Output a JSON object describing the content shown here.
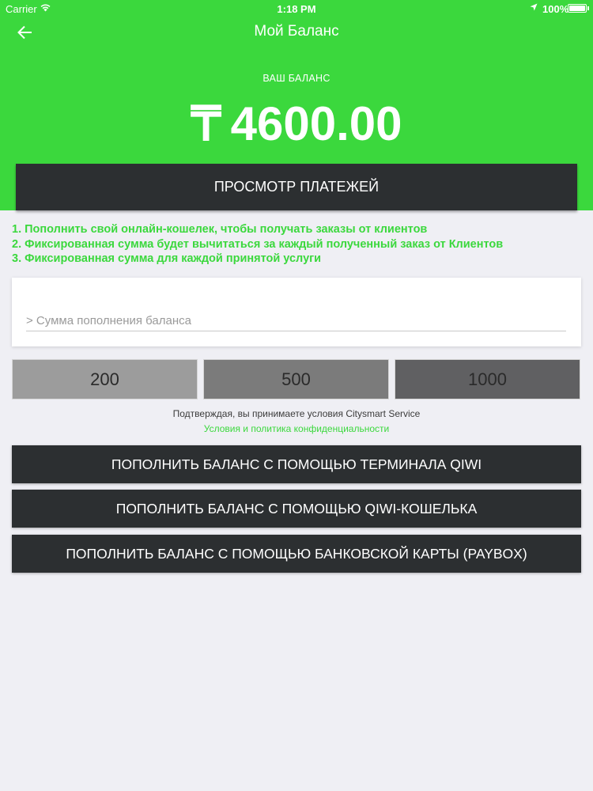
{
  "status_bar": {
    "carrier": "Carrier",
    "time": "1:18 PM",
    "battery": "100%"
  },
  "nav": {
    "title": "Мой Баланс",
    "back_icon": "arrow-left-icon"
  },
  "balance": {
    "label": "ВАШ БАЛАНС",
    "currency_symbol": "₸",
    "amount": "4600.00"
  },
  "payments_button": "ПРОСМОТР ПЛАТЕЖЕЙ",
  "info_lines": [
    "1. Пополнить свой онлайн-кошелек, чтобы получать заказы от клиентов",
    "2. Фиксированная сумма будет вычитаться за каждый полученный заказ от Клиентов",
    "3. Фиксированная сумма для каждой принятой услуги"
  ],
  "amount_input": {
    "value": "",
    "placeholder": "> Сумма пополнения баланса"
  },
  "presets": [
    "200",
    "500",
    "1000"
  ],
  "terms": {
    "text": "Подтверждая, вы принимаете условия Citysmart Service",
    "link": "Условия и политика конфиденциальности"
  },
  "actions": [
    "ПОПОЛНИТЬ БАЛАНС С ПОМОЩЬЮ ТЕРМИНАЛА QIWI",
    "ПОПОЛНИТЬ БАЛАНС С ПОМОЩЬЮ QIWI-КОШЕЛЬКА",
    "ПОПОЛНИТЬ БАЛАНС С ПОМОЩЬЮ БАНКОВСКОЙ КАРТЫ (PAYBOX)"
  ],
  "colors": {
    "accent": "#3bd83d",
    "dark_button": "#2c2f31",
    "background": "#efeff4"
  }
}
